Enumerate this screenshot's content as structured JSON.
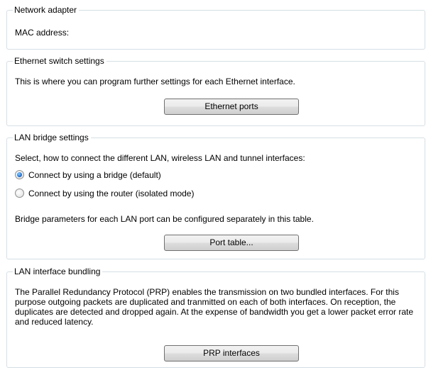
{
  "network_adapter": {
    "title": "Network adapter",
    "mac_label": "MAC address:"
  },
  "ethernet_switch": {
    "title": "Ethernet switch settings",
    "description": "This is where you can program further settings for each Ethernet interface.",
    "button_label": "Ethernet ports"
  },
  "lan_bridge": {
    "title": "LAN bridge settings",
    "prompt": "Select, how to connect the different LAN, wireless LAN and tunnel interfaces:",
    "options": [
      {
        "label": "Connect by using a bridge (default)",
        "selected": true
      },
      {
        "label": "Connect by using the router (isolated mode)",
        "selected": false
      }
    ],
    "note": "Bridge parameters for each LAN port can be configured separately in this table.",
    "button_label": "Port table..."
  },
  "lan_bundling": {
    "title": "LAN interface bundling",
    "description": "The Parallel Redundancy Protocol (PRP) enables the transmission on two bundled interfaces. For this purpose outgoing packets are duplicated and tranmitted on each of both interfaces. On reception, the duplicates are detected and dropped again. At the expense of bandwidth you get a lower packet error rate and reduced latency.",
    "button_label": "PRP interfaces"
  }
}
